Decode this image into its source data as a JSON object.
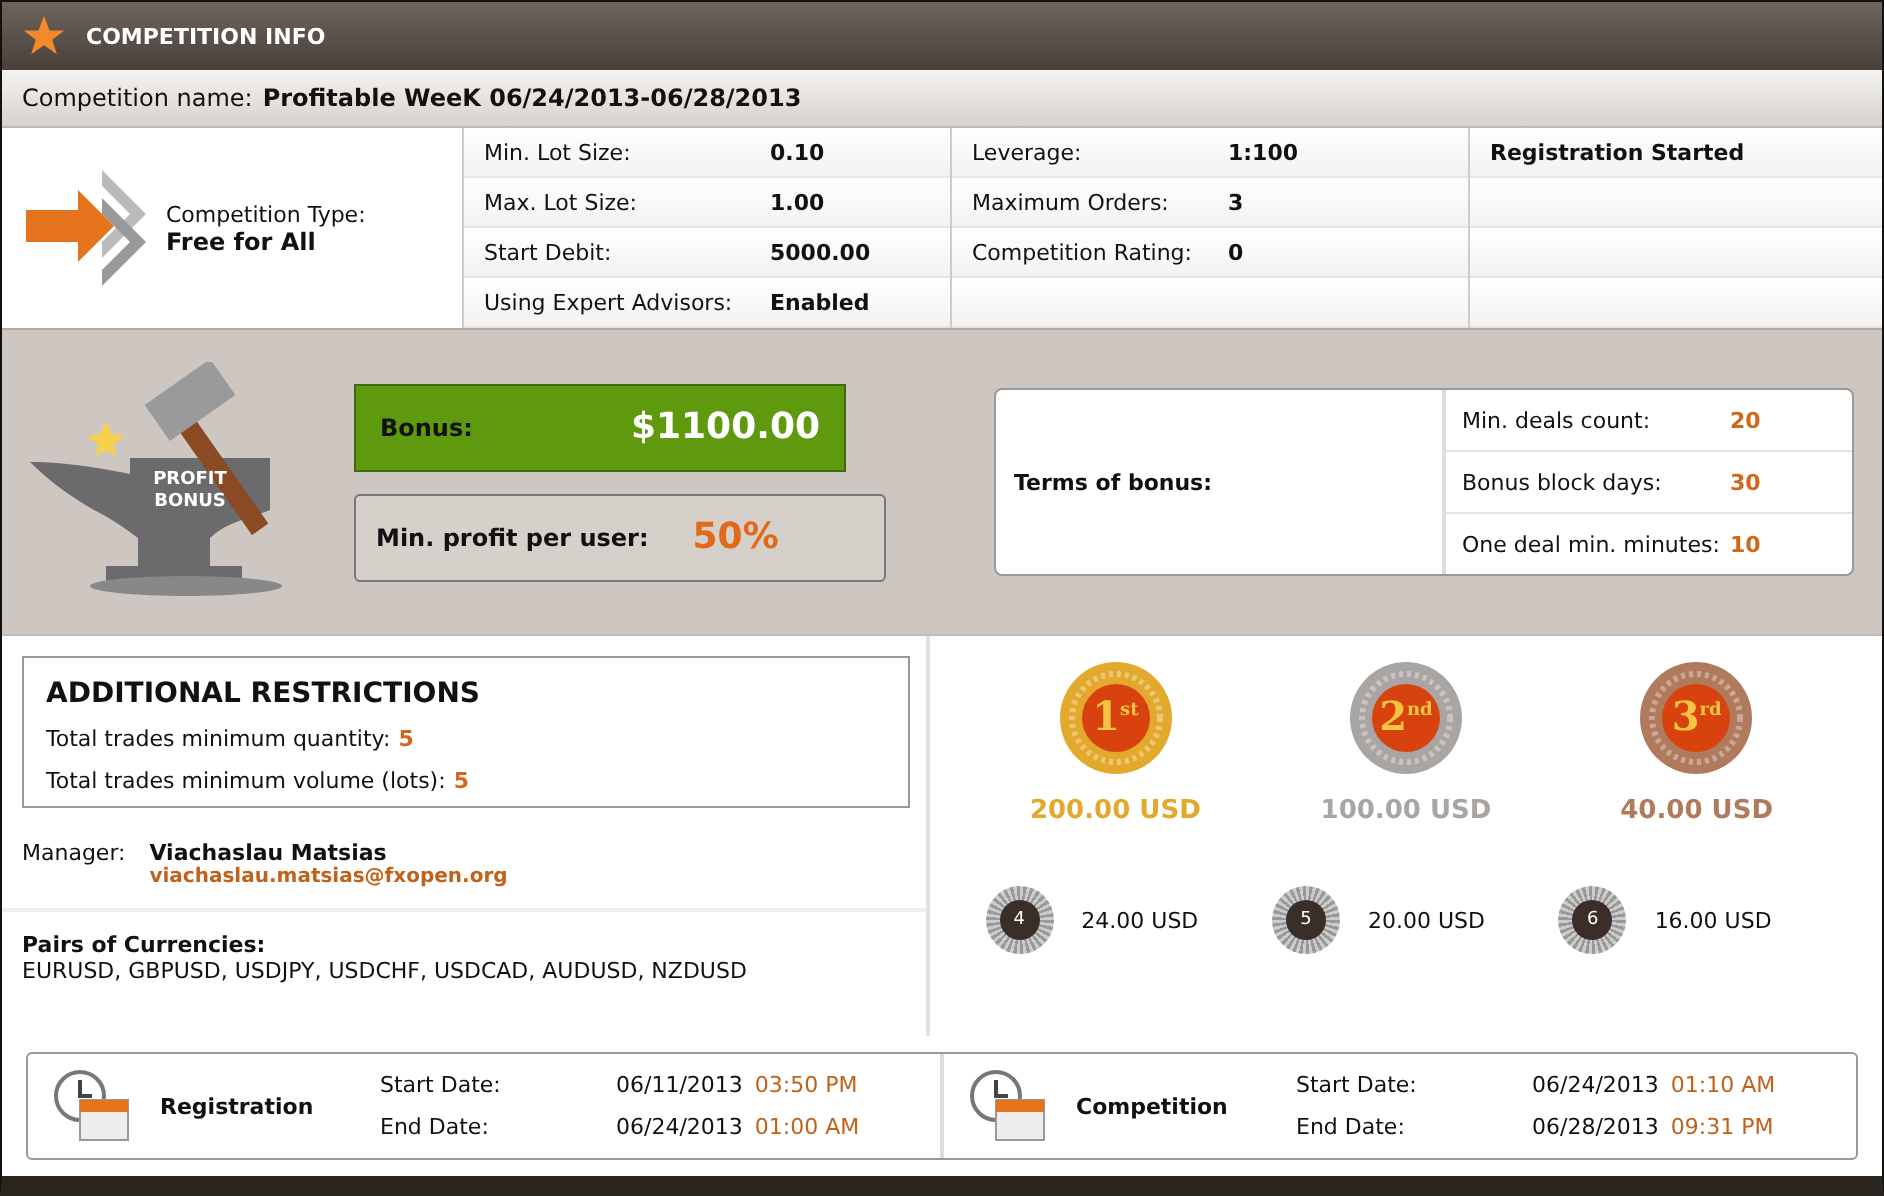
{
  "header": {
    "title": "COMPETITION INFO"
  },
  "competition_name": {
    "label": "Competition name:",
    "value": "Profitable WeeK 06/24/2013-06/28/2013"
  },
  "competition_type": {
    "label": "Competition Type:",
    "value": "Free for All"
  },
  "info_columns": [
    [
      {
        "label": "Min. Lot Size:",
        "value": "0.10"
      },
      {
        "label": "Max. Lot Size:",
        "value": "1.00"
      },
      {
        "label": "Start Debit:",
        "value": "5000.00"
      },
      {
        "label": "Using Expert Advisors:",
        "value": "Enabled"
      }
    ],
    [
      {
        "label": "Leverage:",
        "value": "1:100"
      },
      {
        "label": "Maximum Orders:",
        "value": "3"
      },
      {
        "label": "Competition Rating:",
        "value": "0"
      }
    ]
  ],
  "status": "Registration Started",
  "anvil_text": "PROFIT BONUS",
  "bonus": {
    "label": "Bonus:",
    "value": "$1100.00"
  },
  "min_profit": {
    "label": "Min. profit per user:",
    "value": "50%"
  },
  "terms": {
    "label": "Terms of bonus:",
    "rows": [
      {
        "label": "Min. deals count:",
        "value": "20"
      },
      {
        "label": "Bonus block days:",
        "value": "30"
      },
      {
        "label": "One deal min. minutes:",
        "value": "10"
      }
    ]
  },
  "restrictions": {
    "title": "ADDITIONAL RESTRICTIONS",
    "rows": [
      {
        "label": "Total trades minimum quantity:",
        "value": "5"
      },
      {
        "label": "Total trades minimum volume (lots):",
        "value": "5"
      }
    ]
  },
  "manager": {
    "label": "Manager:",
    "name": "Viachaslau Matsias",
    "email": "viachaslau.matsias@fxopen.org"
  },
  "pairs": {
    "label": "Pairs of Currencies:",
    "value": "EURUSD, GBPUSD, USDJPY, USDCHF, USDCAD, AUDUSD, NZDUSD"
  },
  "top_prizes": [
    {
      "rank": "1$^{st}$",
      "amount": "200.00 USD",
      "color": "#e2a92c"
    },
    {
      "rank": "2$^{nd}$",
      "amount": "100.00 USD",
      "color": "#a9a5a2"
    },
    {
      "rank": "3$^{rd}$",
      "amount": "40.00 USD",
      "color": "#b07a5c"
    }
  ],
  "other_prizes": [
    {
      "rank": "4",
      "amount": "24.00 USD"
    },
    {
      "rank": "5",
      "amount": "20.00 USD"
    },
    {
      "rank": "6",
      "amount": "16.00 USD"
    }
  ],
  "periods": [
    {
      "title": "Registration",
      "rows": [
        {
          "label": "Start Date:",
          "date": "06/11/2013",
          "time": "03:50 PM"
        },
        {
          "label": "End Date:",
          "date": "06/24/2013",
          "time": "01:00 AM"
        }
      ]
    },
    {
      "title": "Competition",
      "rows": [
        {
          "label": "Start Date:",
          "date": "06/24/2013",
          "time": "01:10 AM"
        },
        {
          "label": "End Date:",
          "date": "06/28/2013",
          "time": "09:31 PM"
        }
      ]
    }
  ]
}
